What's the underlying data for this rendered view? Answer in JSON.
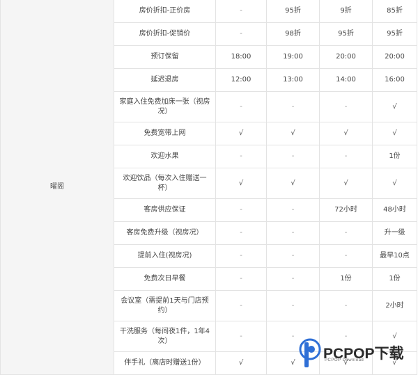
{
  "table": {
    "group_label": "曜阁",
    "rows": [
      {
        "label": "房价折扣-正价房",
        "cells": [
          "-",
          "95折",
          "9折",
          "85折"
        ]
      },
      {
        "label": "房价折扣-促销价",
        "cells": [
          "-",
          "98折",
          "95折",
          "95折"
        ]
      },
      {
        "label": "预订保留",
        "cells": [
          "18:00",
          "19:00",
          "20:00",
          "20:00"
        ]
      },
      {
        "label": "延迟退房",
        "cells": [
          "12:00",
          "13:00",
          "14:00",
          "16:00"
        ]
      },
      {
        "label": "家庭入住免费加床一张（视房况）",
        "cells": [
          "-",
          "-",
          "-",
          "√"
        ]
      },
      {
        "label": "免费宽带上网",
        "cells": [
          "√",
          "√",
          "√",
          "√"
        ]
      },
      {
        "label": "欢迎水果",
        "cells": [
          "-",
          "-",
          "-",
          "1份"
        ]
      },
      {
        "label": "欢迎饮品（每次入住赠送一杯）",
        "cells": [
          "√",
          "√",
          "√",
          "√"
        ]
      },
      {
        "label": "客房供应保证",
        "cells": [
          "-",
          "-",
          "72小时",
          "48小时"
        ]
      },
      {
        "label": "客房免费升级（视房况）",
        "cells": [
          "-",
          "-",
          "-",
          "升一级"
        ]
      },
      {
        "label": "提前入住(视房况)",
        "cells": [
          "-",
          "-",
          "-",
          "最早10点"
        ]
      },
      {
        "label": "免费次日早餐",
        "cells": [
          "-",
          "-",
          "1份",
          "1份"
        ]
      },
      {
        "label": "会议室（需提前1天与门店预约）",
        "cells": [
          "-",
          "-",
          "-",
          "2小时"
        ]
      },
      {
        "label": "干洗服务（每间夜1件，1年4次）",
        "cells": [
          "-",
          "-",
          "-",
          "√"
        ]
      },
      {
        "label": "伴手礼（离店时赠送1份）",
        "cells": [
          "√",
          "√",
          "√",
          "√"
        ]
      }
    ]
  },
  "watermark": {
    "brand": "PCPOP下载",
    "sub": "PCPOP Download",
    "colors": {
      "blue": "#2f6fd6",
      "dark": "#2b2b2b"
    }
  }
}
